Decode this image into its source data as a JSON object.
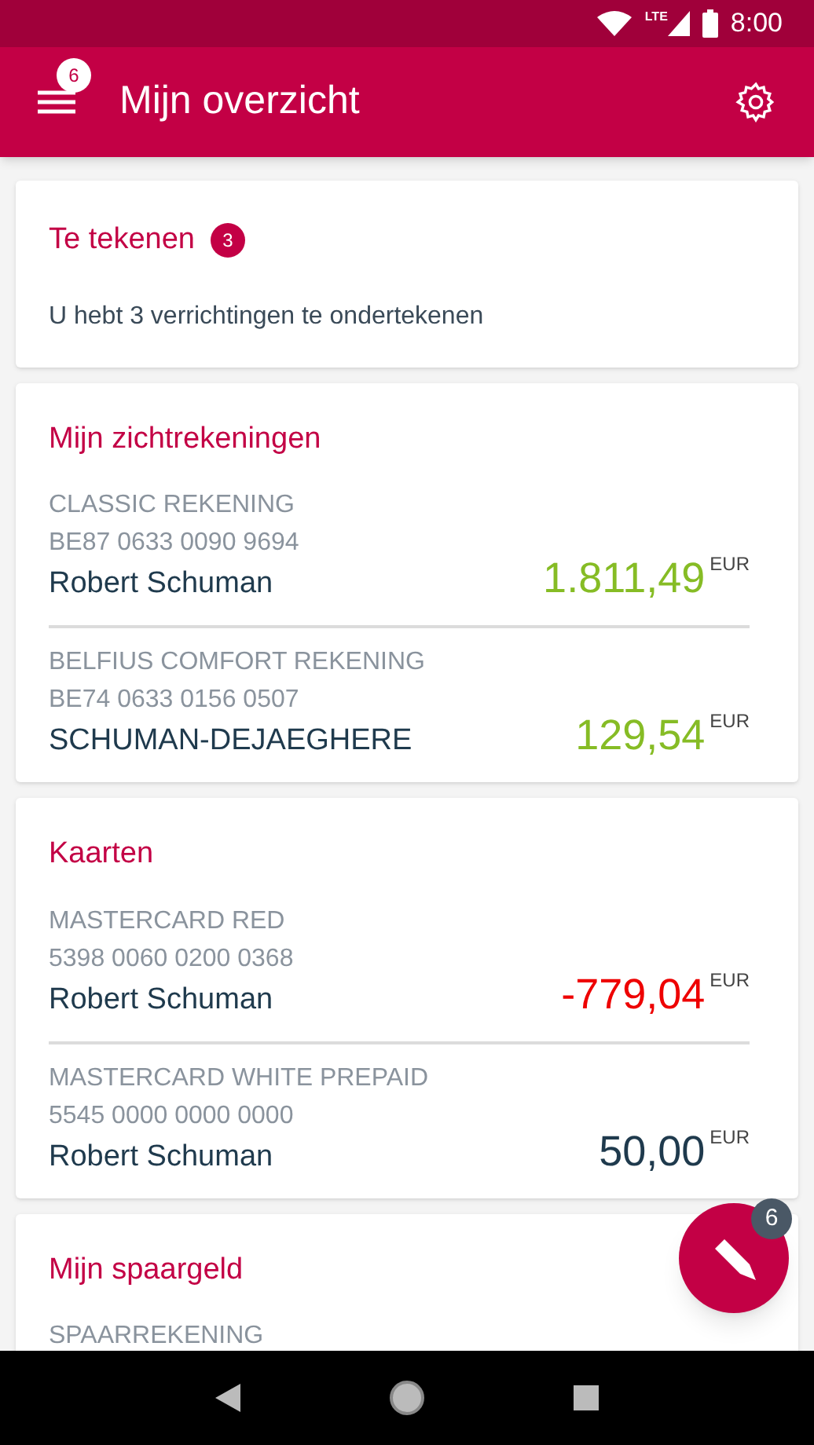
{
  "status_bar": {
    "network": "LTE",
    "time": "8:00"
  },
  "app_bar": {
    "title": "Mijn overzicht",
    "menu_badge": "6"
  },
  "sign_card": {
    "title": "Te tekenen",
    "badge": "3",
    "text": "U hebt 3 verrichtingen te ondertekenen"
  },
  "sections": [
    {
      "title": "Mijn zichtrekeningen",
      "items": [
        {
          "type": "CLASSIC REKENING",
          "number": "BE87 0633 0090 9694",
          "holder": "Robert Schuman",
          "amount": "1.811,49",
          "currency": "EUR",
          "color": "#86bc25"
        },
        {
          "type": "BELFIUS COMFORT REKENING",
          "number": "BE74 0633 0156 0507",
          "holder": "SCHUMAN-DEJAEGHERE",
          "amount": "129,54",
          "currency": "EUR",
          "color": "#86bc25"
        }
      ]
    },
    {
      "title": "Kaarten",
      "items": [
        {
          "type": "MASTERCARD RED",
          "number": "5398 0060 0200 0368",
          "holder": "Robert Schuman",
          "amount": "-779,04",
          "currency": "EUR",
          "color": "#ee0000"
        },
        {
          "type": "MASTERCARD WHITE PREPAID",
          "number": "5545 0000 0000 0000",
          "holder": "Robert Schuman",
          "amount": "50,00",
          "currency": "EUR",
          "color": "#1f3a4d"
        }
      ]
    },
    {
      "title": "Mijn spaargeld",
      "items": [
        {
          "type": "SPAARREKENING"
        }
      ]
    }
  ],
  "fab": {
    "badge": "6"
  }
}
